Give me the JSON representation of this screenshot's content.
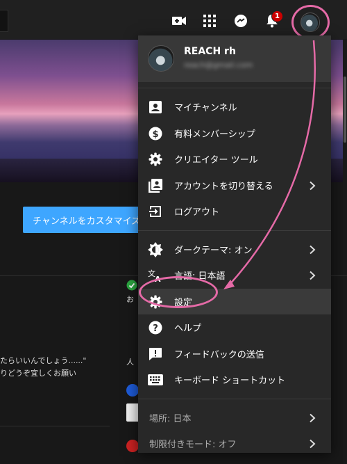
{
  "app": {
    "accent": "#3ea6ff",
    "annotation_color": "#e56aa7"
  },
  "topbar": {
    "icons": [
      "video-camera-icon",
      "apps-grid-icon",
      "messenger-icon",
      "bell-icon"
    ],
    "notification_count": "1"
  },
  "page": {
    "customize_button": "チャンネルをカスタマイズ",
    "text_line_1": "たらいいんでしょう......\"",
    "text_line_2": "りどうぞ宜しくお願い",
    "side_text_1": "お",
    "side_text_2": "人"
  },
  "account": {
    "name": "REACH rh",
    "email": "reach@gmail.com"
  },
  "menu": {
    "group1": [
      {
        "label": "マイチャンネル",
        "icon": "person-box-icon"
      },
      {
        "label": "有料メンバーシップ",
        "icon": "dollar-circle-icon"
      },
      {
        "label": "クリエイター ツール",
        "icon": "gear-icon"
      },
      {
        "label": "アカウントを切り替える",
        "icon": "switch-account-icon"
      },
      {
        "label": "ログアウト",
        "icon": "logout-icon"
      }
    ],
    "group2": [
      {
        "label": "ダークテーマ: オン",
        "icon": "theme-icon"
      },
      {
        "label": "言語: 日本語",
        "icon": "translate-icon"
      },
      {
        "label": "設定",
        "icon": "gear-icon"
      },
      {
        "label": "ヘルプ",
        "icon": "help-icon"
      },
      {
        "label": "フィードバックの送信",
        "icon": "feedback-icon"
      },
      {
        "label": "キーボード ショートカット",
        "icon": "keyboard-icon"
      }
    ],
    "group3": [
      {
        "label": "場所: 日本"
      },
      {
        "label": "制限付きモード: オフ"
      }
    ]
  }
}
